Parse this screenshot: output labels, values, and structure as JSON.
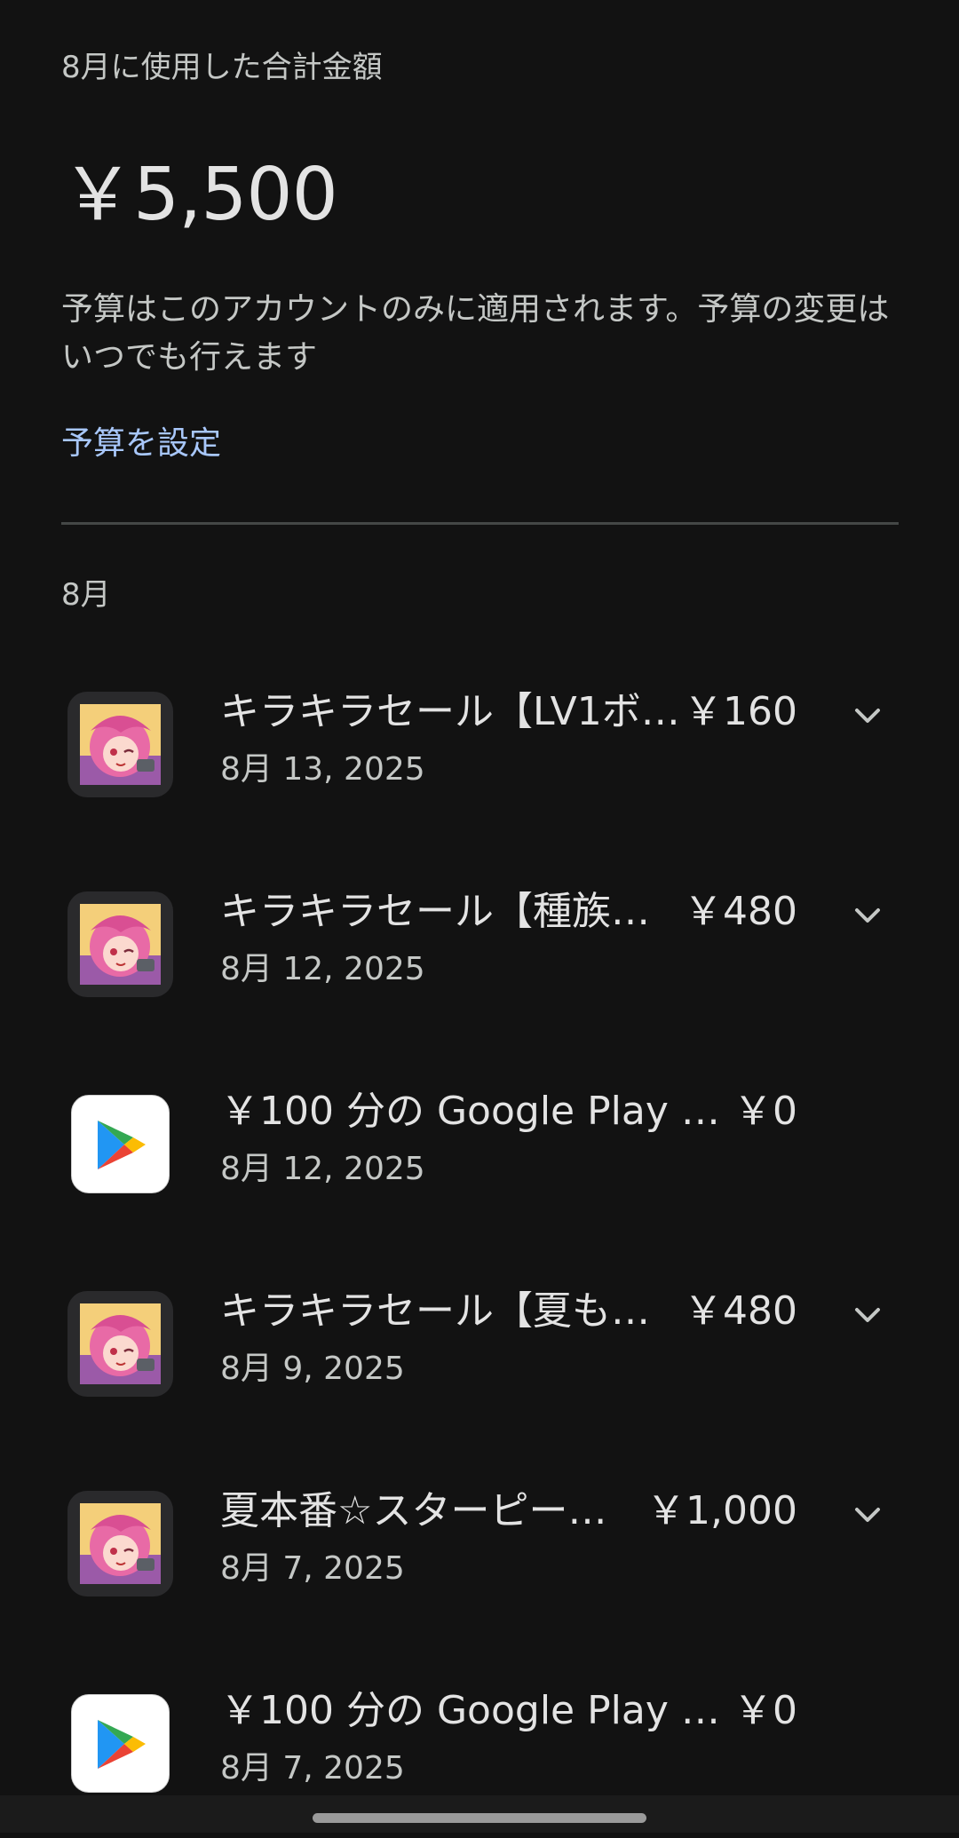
{
  "summary": {
    "label": "8月に使用した合計金額",
    "total": "￥5,500"
  },
  "budget": {
    "note": "予算はこのアカウントのみに適用されます。予算の変更はいつでも行えます",
    "link_label": "予算を設定"
  },
  "month_header": "8月",
  "transactions": [
    {
      "title": "キラキラセール【LV1ボ…",
      "date": "8月 13, 2025",
      "amount": "￥160",
      "icon": "game-app-icon",
      "expandable": true
    },
    {
      "title": "キラキラセール【種族…",
      "date": "8月 12, 2025",
      "amount": "￥480",
      "icon": "game-app-icon",
      "expandable": true
    },
    {
      "title": "￥100 分の Google Play …",
      "date": "8月 12, 2025",
      "amount": "￥0",
      "icon": "google-play-icon",
      "expandable": false
    },
    {
      "title": "キラキラセール【夏も…",
      "date": "8月 9, 2025",
      "amount": "￥480",
      "icon": "game-app-icon",
      "expandable": true
    },
    {
      "title": "夏本番☆スターピー…",
      "date": "8月 7, 2025",
      "amount": "￥1,000",
      "icon": "game-app-icon",
      "expandable": true
    },
    {
      "title": "￥100 分の Google Play …",
      "date": "8月 7, 2025",
      "amount": "￥0",
      "icon": "google-play-icon",
      "expandable": false
    }
  ],
  "colors": {
    "background": "#121212",
    "link": "#a8c7fa",
    "text_primary": "#e3e3e3",
    "text_secondary": "#c4c7c5"
  }
}
